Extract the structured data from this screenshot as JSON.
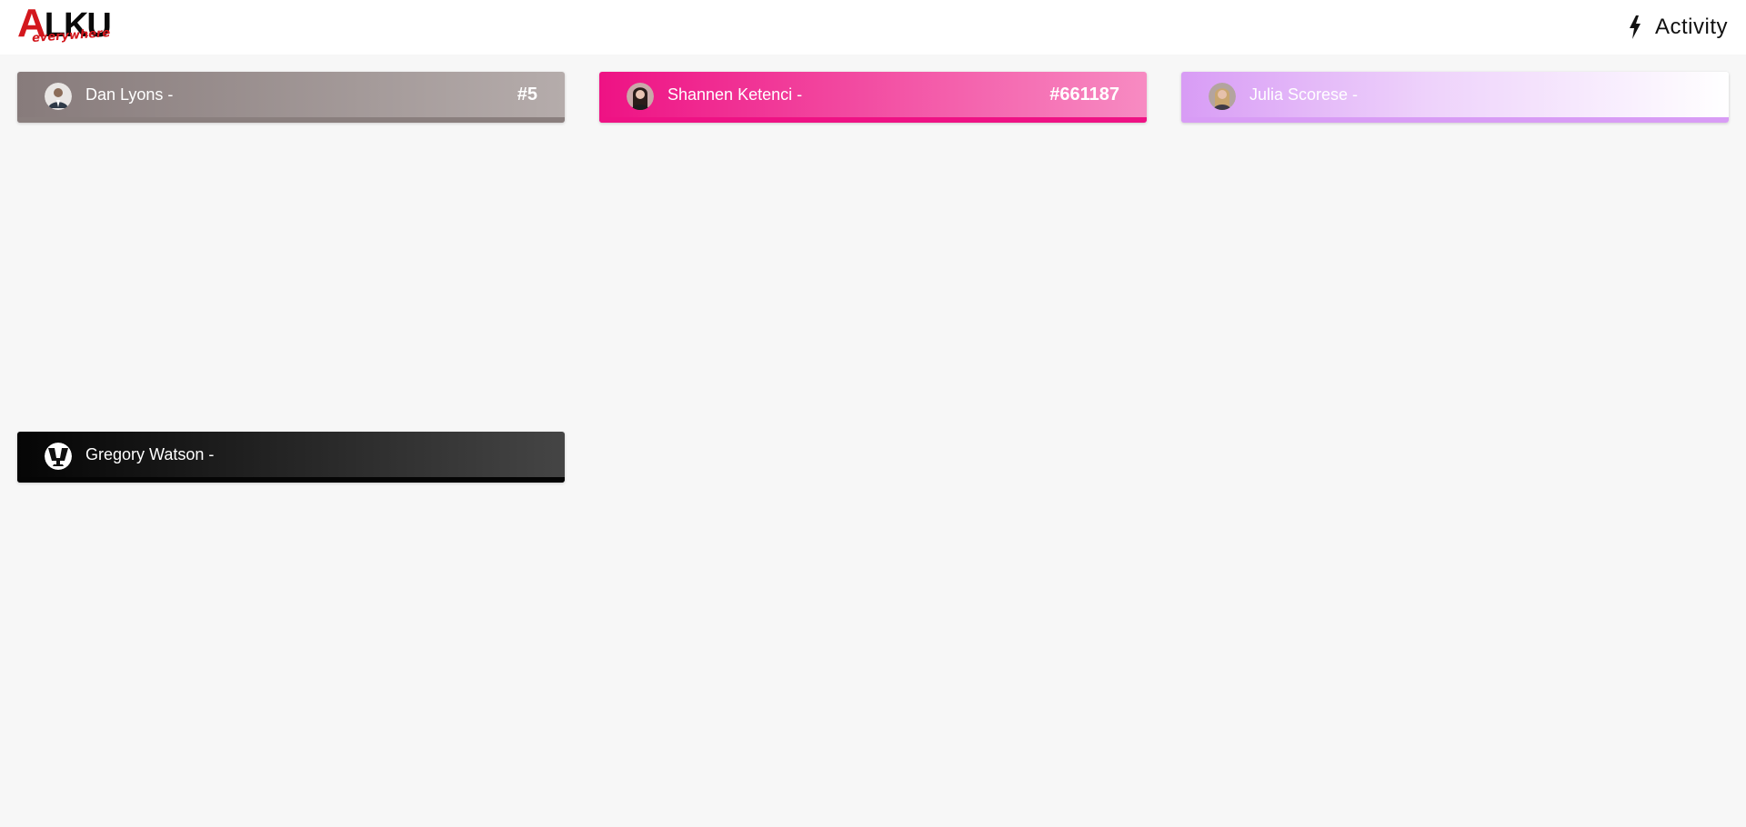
{
  "header": {
    "logo_main_letter": "A",
    "logo_main_rest": "LKU",
    "logo_sub": "everywhere",
    "activity_label": "Activity",
    "activity_icon": "lightning-bolt-icon"
  },
  "cards": [
    {
      "name": "Dan Lyons -",
      "number": "#5",
      "avatar_icon": "user-avatar-icon",
      "colors": {
        "start": "#877b7b",
        "end": "#b5acab",
        "stripe": "#8a7f7e"
      }
    },
    {
      "name": "Shannen Ketenci -",
      "number": "#661187",
      "avatar_icon": "user-avatar-icon",
      "colors": {
        "start": "#ee1284",
        "end": "#f78bc2",
        "stripe": "#ee1284"
      }
    },
    {
      "name": "Julia Scorese -",
      "number": "",
      "avatar_icon": "user-avatar-icon",
      "colors": {
        "start": "#d89cf5",
        "end": "#ffffff",
        "stripe": "#d89cf5"
      }
    },
    {
      "name": "Gregory Watson -",
      "number": "",
      "avatar_icon": "user-avatar-icon",
      "colors": {
        "start": "#050505",
        "end": "#454545",
        "stripe": "#050505"
      }
    }
  ]
}
